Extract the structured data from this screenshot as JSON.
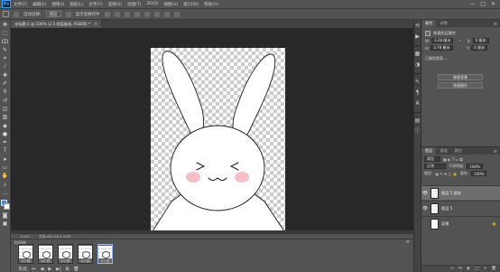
{
  "app": {
    "logo": "Ps"
  },
  "menu": [
    "文件(F)",
    "编辑(E)",
    "图像(I)",
    "图层(L)",
    "文字(Y)",
    "选择(S)",
    "滤镜(T)",
    "3D(D)",
    "视图(V)",
    "窗口(W)",
    "帮助(H)"
  ],
  "window_controls": [
    "—",
    "□",
    "✕"
  ],
  "options": {
    "auto_select_label": "自动选择:",
    "auto_select_value": "图层",
    "show_transform_label": "显示变换控件"
  },
  "document_tab": {
    "title": "未标题-1 @ 100% (2.5 图层副本, RGB/8) *",
    "close": "×"
  },
  "status": {
    "zoom": "100%",
    "doc_info": "文档:481.6K/1.55M"
  },
  "timeline": {
    "title": "时间轴",
    "frames": [
      {
        "label": "1",
        "delay": "0.1 秒"
      },
      {
        "label": "2",
        "delay": "0.1 秒"
      },
      {
        "label": "3",
        "delay": "0.1 秒"
      },
      {
        "label": "4",
        "delay": "0.1 秒"
      },
      {
        "label": "5",
        "delay": "0.1 秒"
      }
    ],
    "loop": "永远",
    "controls": [
      "⏮",
      "◀",
      "▶",
      "▶|",
      "⧉",
      "🗑"
    ]
  },
  "properties": {
    "tabs": [
      "属性",
      "调整"
    ],
    "title": "像素图层属性",
    "w_label": "W:",
    "w_value": "3.28 厘米",
    "h_label": "H:",
    "h_value": "3.78 厘米",
    "x_label": "X:",
    "x_value": "0 厘米",
    "y_label": "Y:",
    "y_value": "0 厘米",
    "mask_label": "已删除蒙版 ⌄",
    "btn_remove_bg": "移除背景",
    "btn_quick_action": "快速操作"
  },
  "layers": {
    "tabs": [
      "图层",
      "通道",
      "路径"
    ],
    "kind_filter": "类型",
    "blend_mode": "正常",
    "opacity_label": "不透明度:",
    "opacity_value": "100%",
    "lock_label": "锁定:",
    "fill_label": "填充:",
    "fill_value": "100%",
    "items": [
      {
        "name": "图层 5 副本",
        "visible": "👁",
        "selected": true
      },
      {
        "name": "图层 5",
        "visible": "👁",
        "selected": false
      },
      {
        "name": "背景",
        "visible": "",
        "selected": false
      }
    ],
    "footer_icons": [
      "fx",
      "◐",
      "□",
      "+",
      "🗑"
    ]
  },
  "colors": {
    "foreground": "#3a8ee6",
    "background": "#ffffff",
    "blush": "#f7b3bd"
  }
}
